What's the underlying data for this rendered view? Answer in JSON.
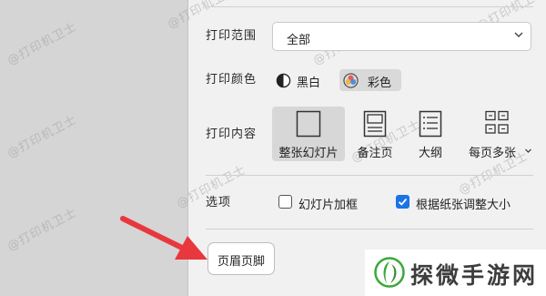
{
  "print_range": {
    "label": "打印范围",
    "selected_value": "全部"
  },
  "print_color": {
    "label": "打印颜色",
    "options": [
      {
        "label": "黑白",
        "icon": "half-circle-icon",
        "selected": false
      },
      {
        "label": "彩色",
        "icon": "color-wheel-icon",
        "selected": true
      }
    ]
  },
  "print_content": {
    "label": "打印内容",
    "options": [
      {
        "label": "整张幻灯片",
        "icon": "full-slide-icon",
        "selected": true
      },
      {
        "label": "备注页",
        "icon": "notes-page-icon",
        "selected": false
      },
      {
        "label": "大纲",
        "icon": "outline-icon",
        "selected": false
      },
      {
        "label": "每页多张",
        "icon": "multi-slide-icon",
        "selected": false,
        "has_dropdown": true
      }
    ]
  },
  "options": {
    "label": "选项",
    "checkboxes": [
      {
        "label": "幻灯片加框",
        "checked": false
      },
      {
        "label": "根据纸张调整大小",
        "checked": true
      }
    ]
  },
  "header_footer_button": {
    "label": "页眉页脚"
  },
  "watermark": {
    "text": "@打印机卫士"
  },
  "site_logo": {
    "text": "探微手游网"
  },
  "colors": {
    "accent": "#1a73e8",
    "arrow": "#e8383d",
    "logo_green": "#3aa83a"
  }
}
